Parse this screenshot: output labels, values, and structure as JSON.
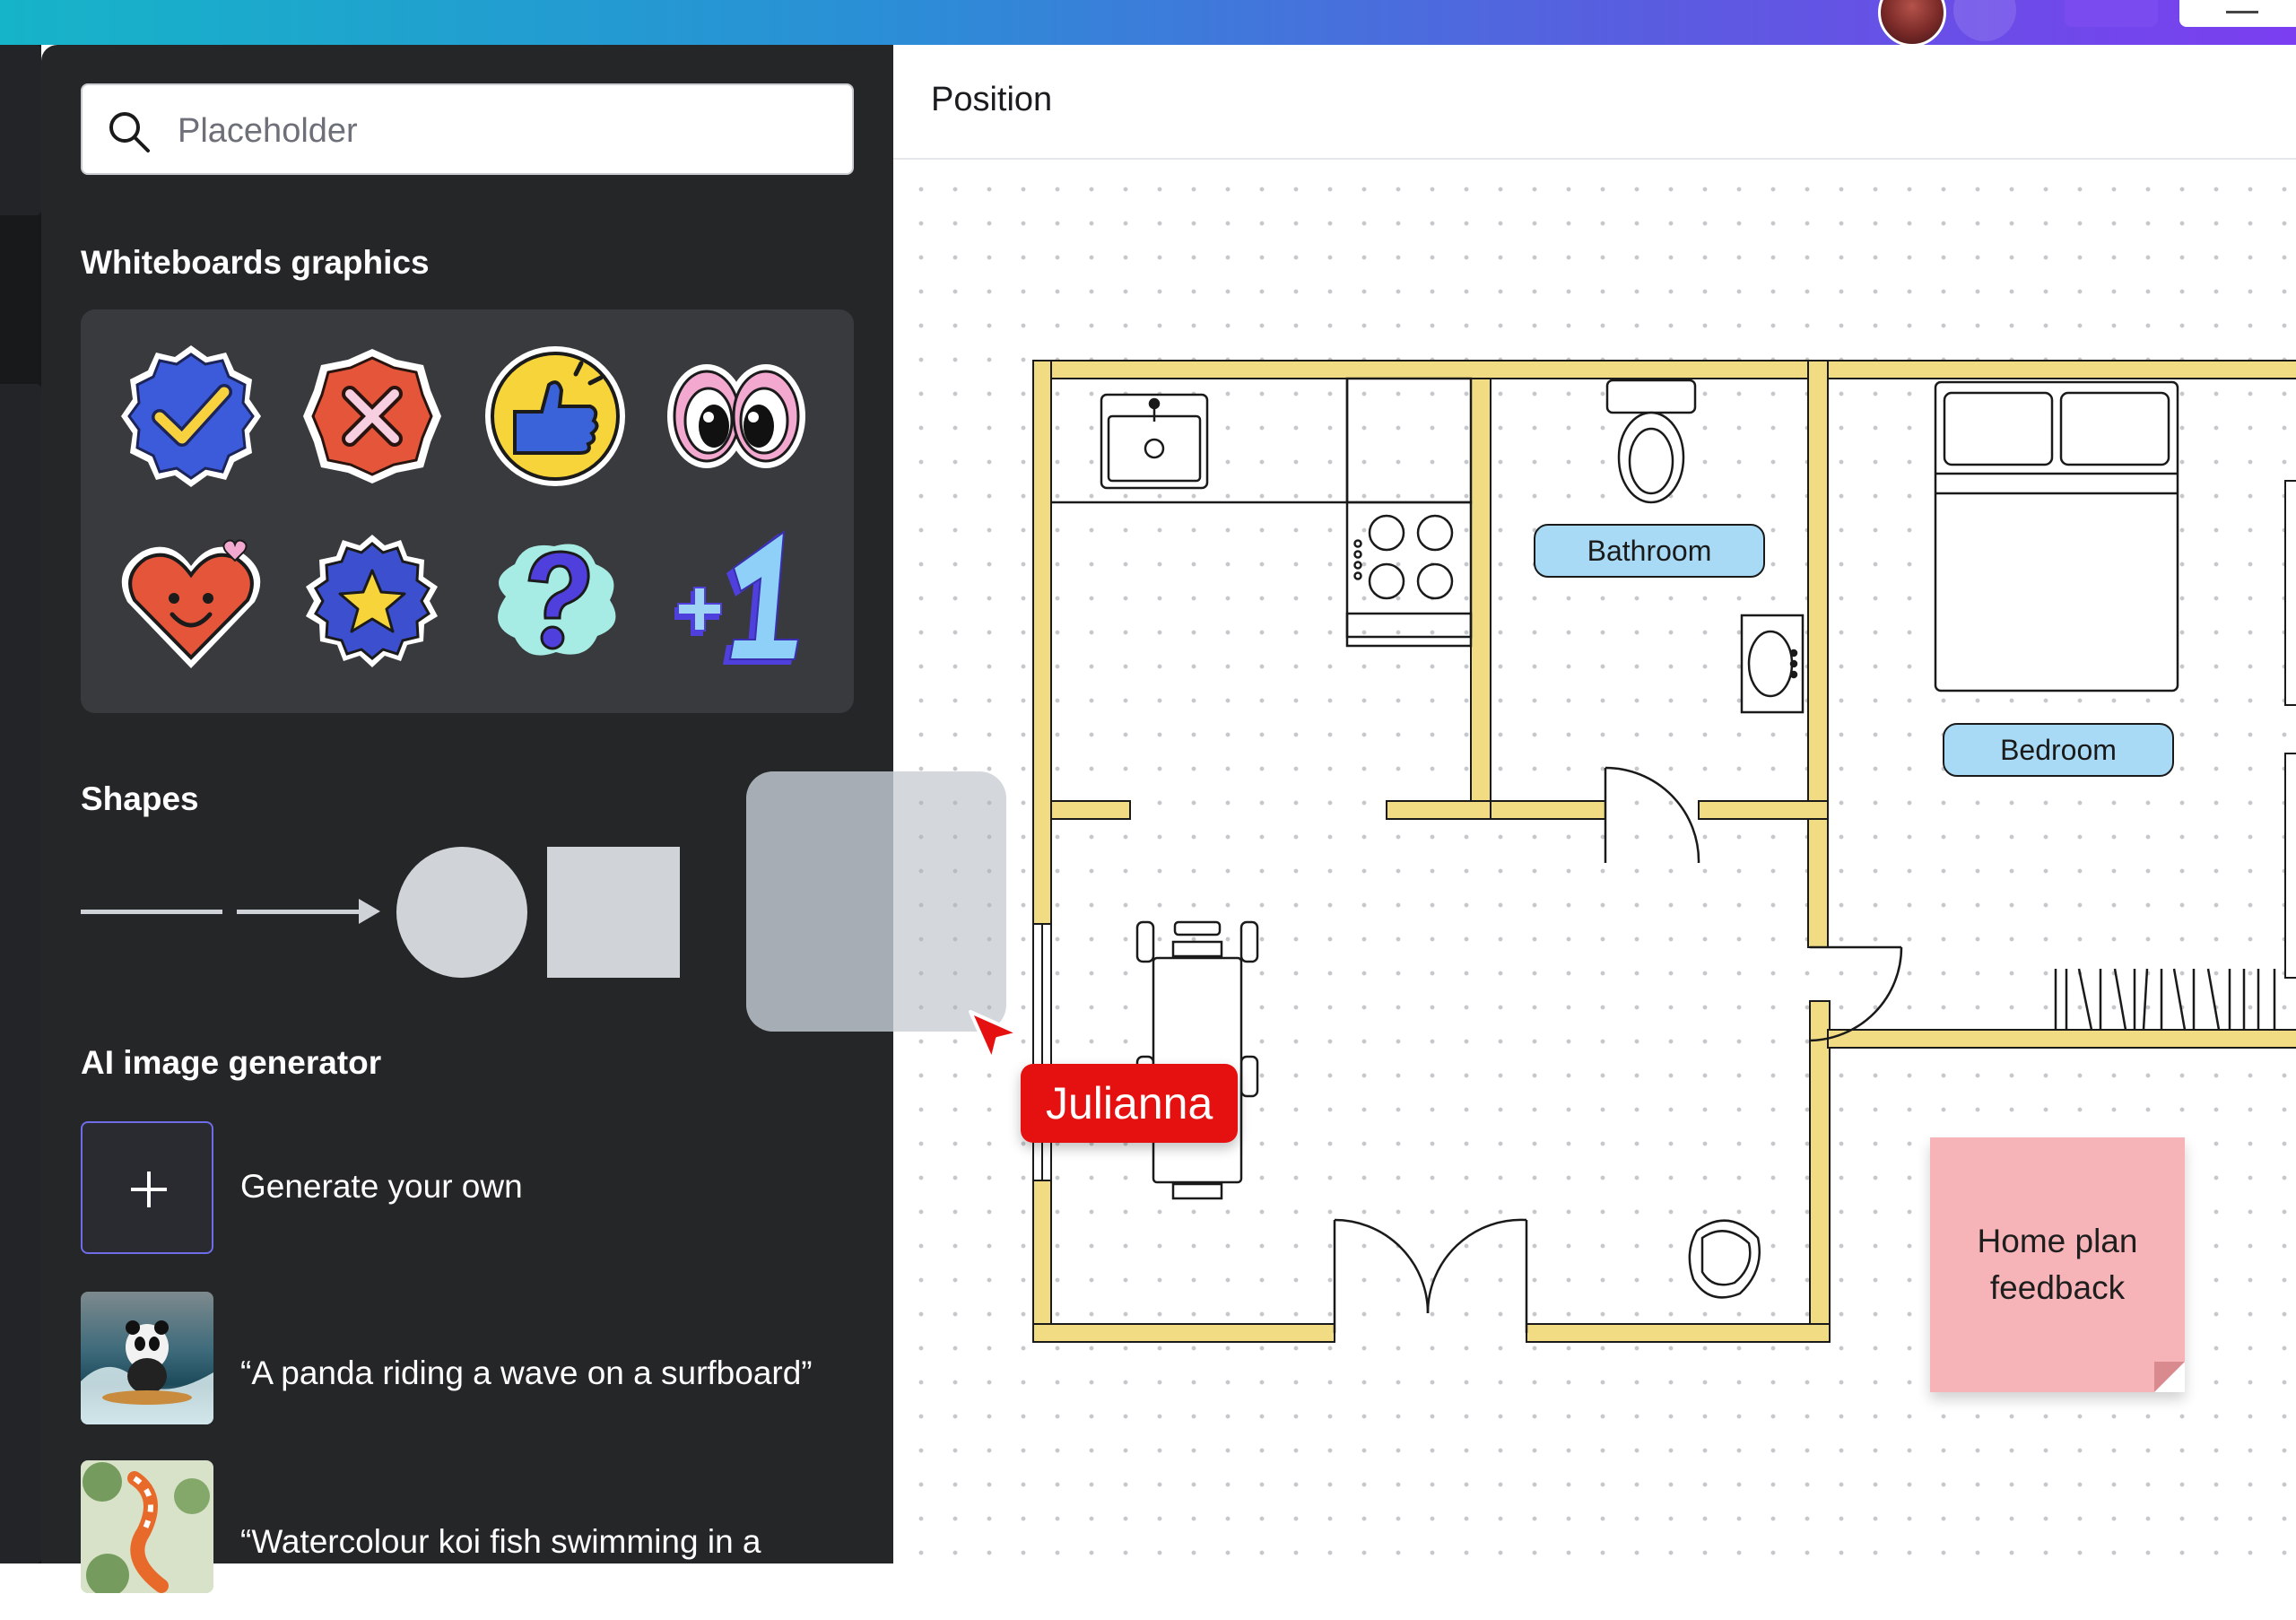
{
  "topbar": {
    "gradient_start": "#16b4c8",
    "gradient_end": "#7b3ef0"
  },
  "search": {
    "placeholder": "Placeholder",
    "value": ""
  },
  "graphics": {
    "title": "Whiteboards graphics",
    "items": [
      "checkmark-badge",
      "x-mark-badge",
      "thumbs-up-badge",
      "googly-eyes",
      "smiling-heart",
      "star-badge",
      "question-mark",
      "plus-one"
    ]
  },
  "shapes": {
    "title": "Shapes",
    "items": [
      "line",
      "arrow",
      "circle",
      "square",
      "rounded-square"
    ]
  },
  "ai_generator": {
    "title": "AI image generator",
    "generate_label": "Generate your own",
    "prompts": [
      {
        "text": "“A panda riding a wave on a surfboard”"
      },
      {
        "text": "“Watercolour koi fish swimming in a pond”"
      }
    ]
  },
  "canvas": {
    "header_title": "Position",
    "room_labels": {
      "bathroom": "Bathroom",
      "bedroom": "Bedroom"
    },
    "sticky_note": "Home plan feedback",
    "sticky_color": "#f7b4b8",
    "wall_color": "#f1dc84",
    "label_color": "#a8daf6"
  },
  "collaborator": {
    "name": "Julianna",
    "color": "#e51111"
  }
}
